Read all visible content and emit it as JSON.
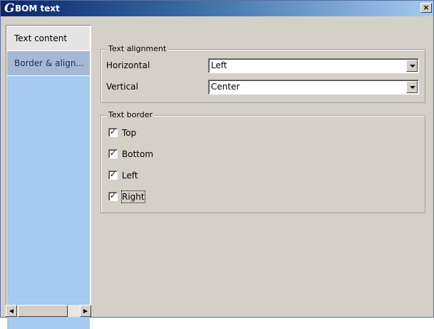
{
  "window": {
    "logo": "G",
    "title": "BOM text",
    "close_glyph": "×"
  },
  "sidebar": {
    "items": [
      {
        "label": "Text content"
      },
      {
        "label": "Border & align..."
      }
    ],
    "selected": "Border & align...",
    "scroll_left_glyph": "◀",
    "scroll_right_glyph": "▶"
  },
  "alignment": {
    "group_label": "Text alignment",
    "horizontal_label": "Horizontal",
    "horizontal_value": "Left",
    "vertical_label": "Vertical",
    "vertical_value": "Center"
  },
  "border": {
    "group_label": "Text border",
    "options": [
      {
        "label": "Top",
        "checked": true
      },
      {
        "label": "Bottom",
        "checked": true
      },
      {
        "label": "Left",
        "checked": true
      },
      {
        "label": "Right",
        "checked": true
      }
    ],
    "check_glyph": "✓"
  },
  "colors": {
    "titlebar_start": "#0a246a",
    "titlebar_end": "#a6caf0",
    "sidebar_selected": "#a6b8d4",
    "dialog_bg": "#d4d0c8"
  }
}
